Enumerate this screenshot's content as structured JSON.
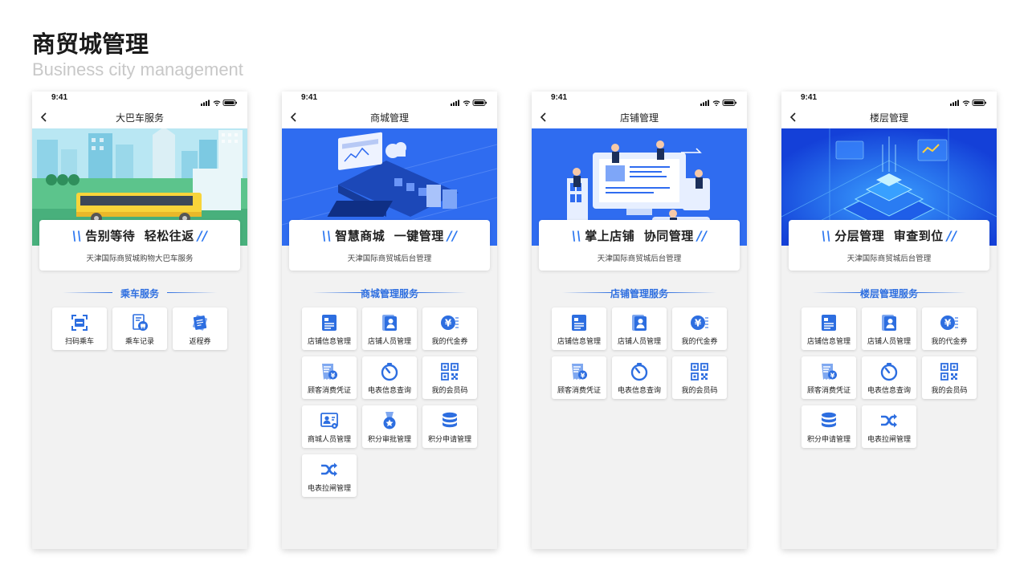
{
  "header": {
    "title": "商贸城管理",
    "subtitle": "Business city management"
  },
  "colors": {
    "brand": "#2d6ee0",
    "banner_blue": "#2f6cf0",
    "icon_blue": "#2d6ee0"
  },
  "phones": [
    {
      "time": "9:41",
      "nav_title": "大巴车服务",
      "slogan_left": "告别等待",
      "slogan_right": "轻松往返",
      "slogan_sub": "天津国际商贸城购物大巴车服务",
      "section_title": "乘车服务",
      "items": [
        {
          "label": "扫码乘车",
          "icon": "scan-icon"
        },
        {
          "label": "乘车记录",
          "icon": "bus-record-icon"
        },
        {
          "label": "返程券",
          "icon": "ticket-icon"
        }
      ]
    },
    {
      "time": "9:41",
      "nav_title": "商城管理",
      "slogan_left": "智慧商城",
      "slogan_right": "一键管理",
      "slogan_sub": "天津国际商贸城后台管理",
      "section_title": "商城管理服务",
      "items": [
        {
          "label": "店铺信息管理",
          "icon": "store-info-icon"
        },
        {
          "label": "店铺人员管理",
          "icon": "store-staff-icon"
        },
        {
          "label": "我的代金券",
          "icon": "voucher-icon"
        },
        {
          "label": "顾客消费凭证",
          "icon": "receipt-icon"
        },
        {
          "label": "电表信息查询",
          "icon": "meter-icon"
        },
        {
          "label": "我的会员码",
          "icon": "qrcode-icon"
        },
        {
          "label": "商城人员管理",
          "icon": "mall-staff-icon"
        },
        {
          "label": "积分审批管理",
          "icon": "medal-icon"
        },
        {
          "label": "积分申请管理",
          "icon": "database-icon"
        },
        {
          "label": "电表拉闸管理",
          "icon": "switch-icon"
        }
      ]
    },
    {
      "time": "9:41",
      "nav_title": "店铺管理",
      "slogan_left": "掌上店铺",
      "slogan_right": "协同管理",
      "slogan_sub": "天津国际商贸城后台管理",
      "section_title": "店铺管理服务",
      "items": [
        {
          "label": "店铺信息管理",
          "icon": "store-info-icon"
        },
        {
          "label": "店铺人员管理",
          "icon": "store-staff-icon"
        },
        {
          "label": "我的代金券",
          "icon": "voucher-icon"
        },
        {
          "label": "顾客消费凭证",
          "icon": "receipt-icon"
        },
        {
          "label": "电表信息查询",
          "icon": "meter-icon"
        },
        {
          "label": "我的会员码",
          "icon": "qrcode-icon"
        }
      ]
    },
    {
      "time": "9:41",
      "nav_title": "楼层管理",
      "slogan_left": "分层管理",
      "slogan_right": "审查到位",
      "slogan_sub": "天津国际商贸城后台管理",
      "section_title": "楼层管理服务",
      "items": [
        {
          "label": "店铺信息管理",
          "icon": "store-info-icon"
        },
        {
          "label": "店铺人员管理",
          "icon": "store-staff-icon"
        },
        {
          "label": "我的代金券",
          "icon": "voucher-icon"
        },
        {
          "label": "顾客消费凭证",
          "icon": "receipt-icon"
        },
        {
          "label": "电表信息查询",
          "icon": "meter-icon"
        },
        {
          "label": "我的会员码",
          "icon": "qrcode-icon"
        },
        {
          "label": "积分申请管理",
          "icon": "database-icon"
        },
        {
          "label": "电表拉闸管理",
          "icon": "switch-icon"
        }
      ]
    }
  ]
}
